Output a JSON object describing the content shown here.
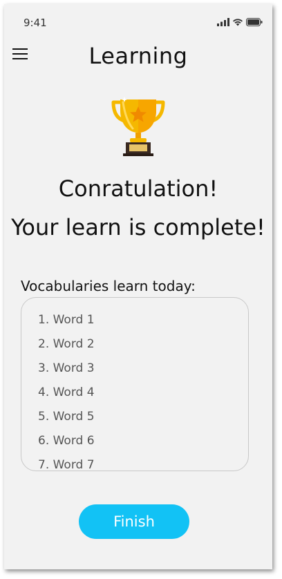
{
  "status_bar": {
    "time": "9:41",
    "icons": [
      "signal-icon",
      "wifi-icon",
      "battery-icon"
    ]
  },
  "header": {
    "title": "Learning",
    "menu_icon": "hamburger-menu-icon"
  },
  "trophy_icon": "trophy-icon",
  "congrats": {
    "line1": "Conratulation!",
    "line2": "Your learn is complete!"
  },
  "vocabulary": {
    "label": "Vocabularies learn today:",
    "items": [
      "1.  Word 1",
      "2. Word 2",
      "3. Word 3",
      "4. Word 4",
      "5. Word 5",
      "6. Word 6",
      "7. Word 7"
    ]
  },
  "finish_button": {
    "label": "Finish"
  },
  "colors": {
    "accent": "#12c2f5",
    "background": "#f2f2f2",
    "trophy_gold": "#f5b800",
    "trophy_base": "#3a2a22"
  }
}
